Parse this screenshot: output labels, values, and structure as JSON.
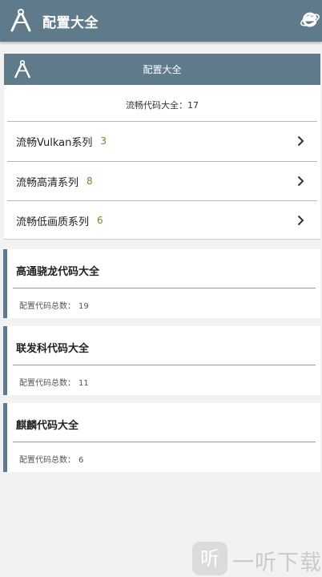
{
  "appbar": {
    "title": "配置大全",
    "logo_icon": "compass-logo-icon",
    "browser_icon": "ie-browser-icon",
    "color": "#5f7a8a"
  },
  "card": {
    "title": "配置大全",
    "summary": "流畅代码大全：17",
    "rows": [
      {
        "label": "流畅Vulkan系列",
        "count": "3"
      },
      {
        "label": "流畅高清系列",
        "count": "8"
      },
      {
        "label": "流畅低画质系列",
        "count": "6"
      }
    ]
  },
  "brands": [
    {
      "name": "高通骁龙代码大全",
      "meta_label": "配置代码总数：",
      "meta_value": "19"
    },
    {
      "name": "联发科代码大全",
      "meta_label": "配置代码总数：",
      "meta_value": "11"
    },
    {
      "name": "麒麟代码大全",
      "meta_label": "配置代码总数：",
      "meta_value": "6"
    }
  ],
  "watermark": {
    "glyph": "听",
    "text": "一听下载"
  }
}
